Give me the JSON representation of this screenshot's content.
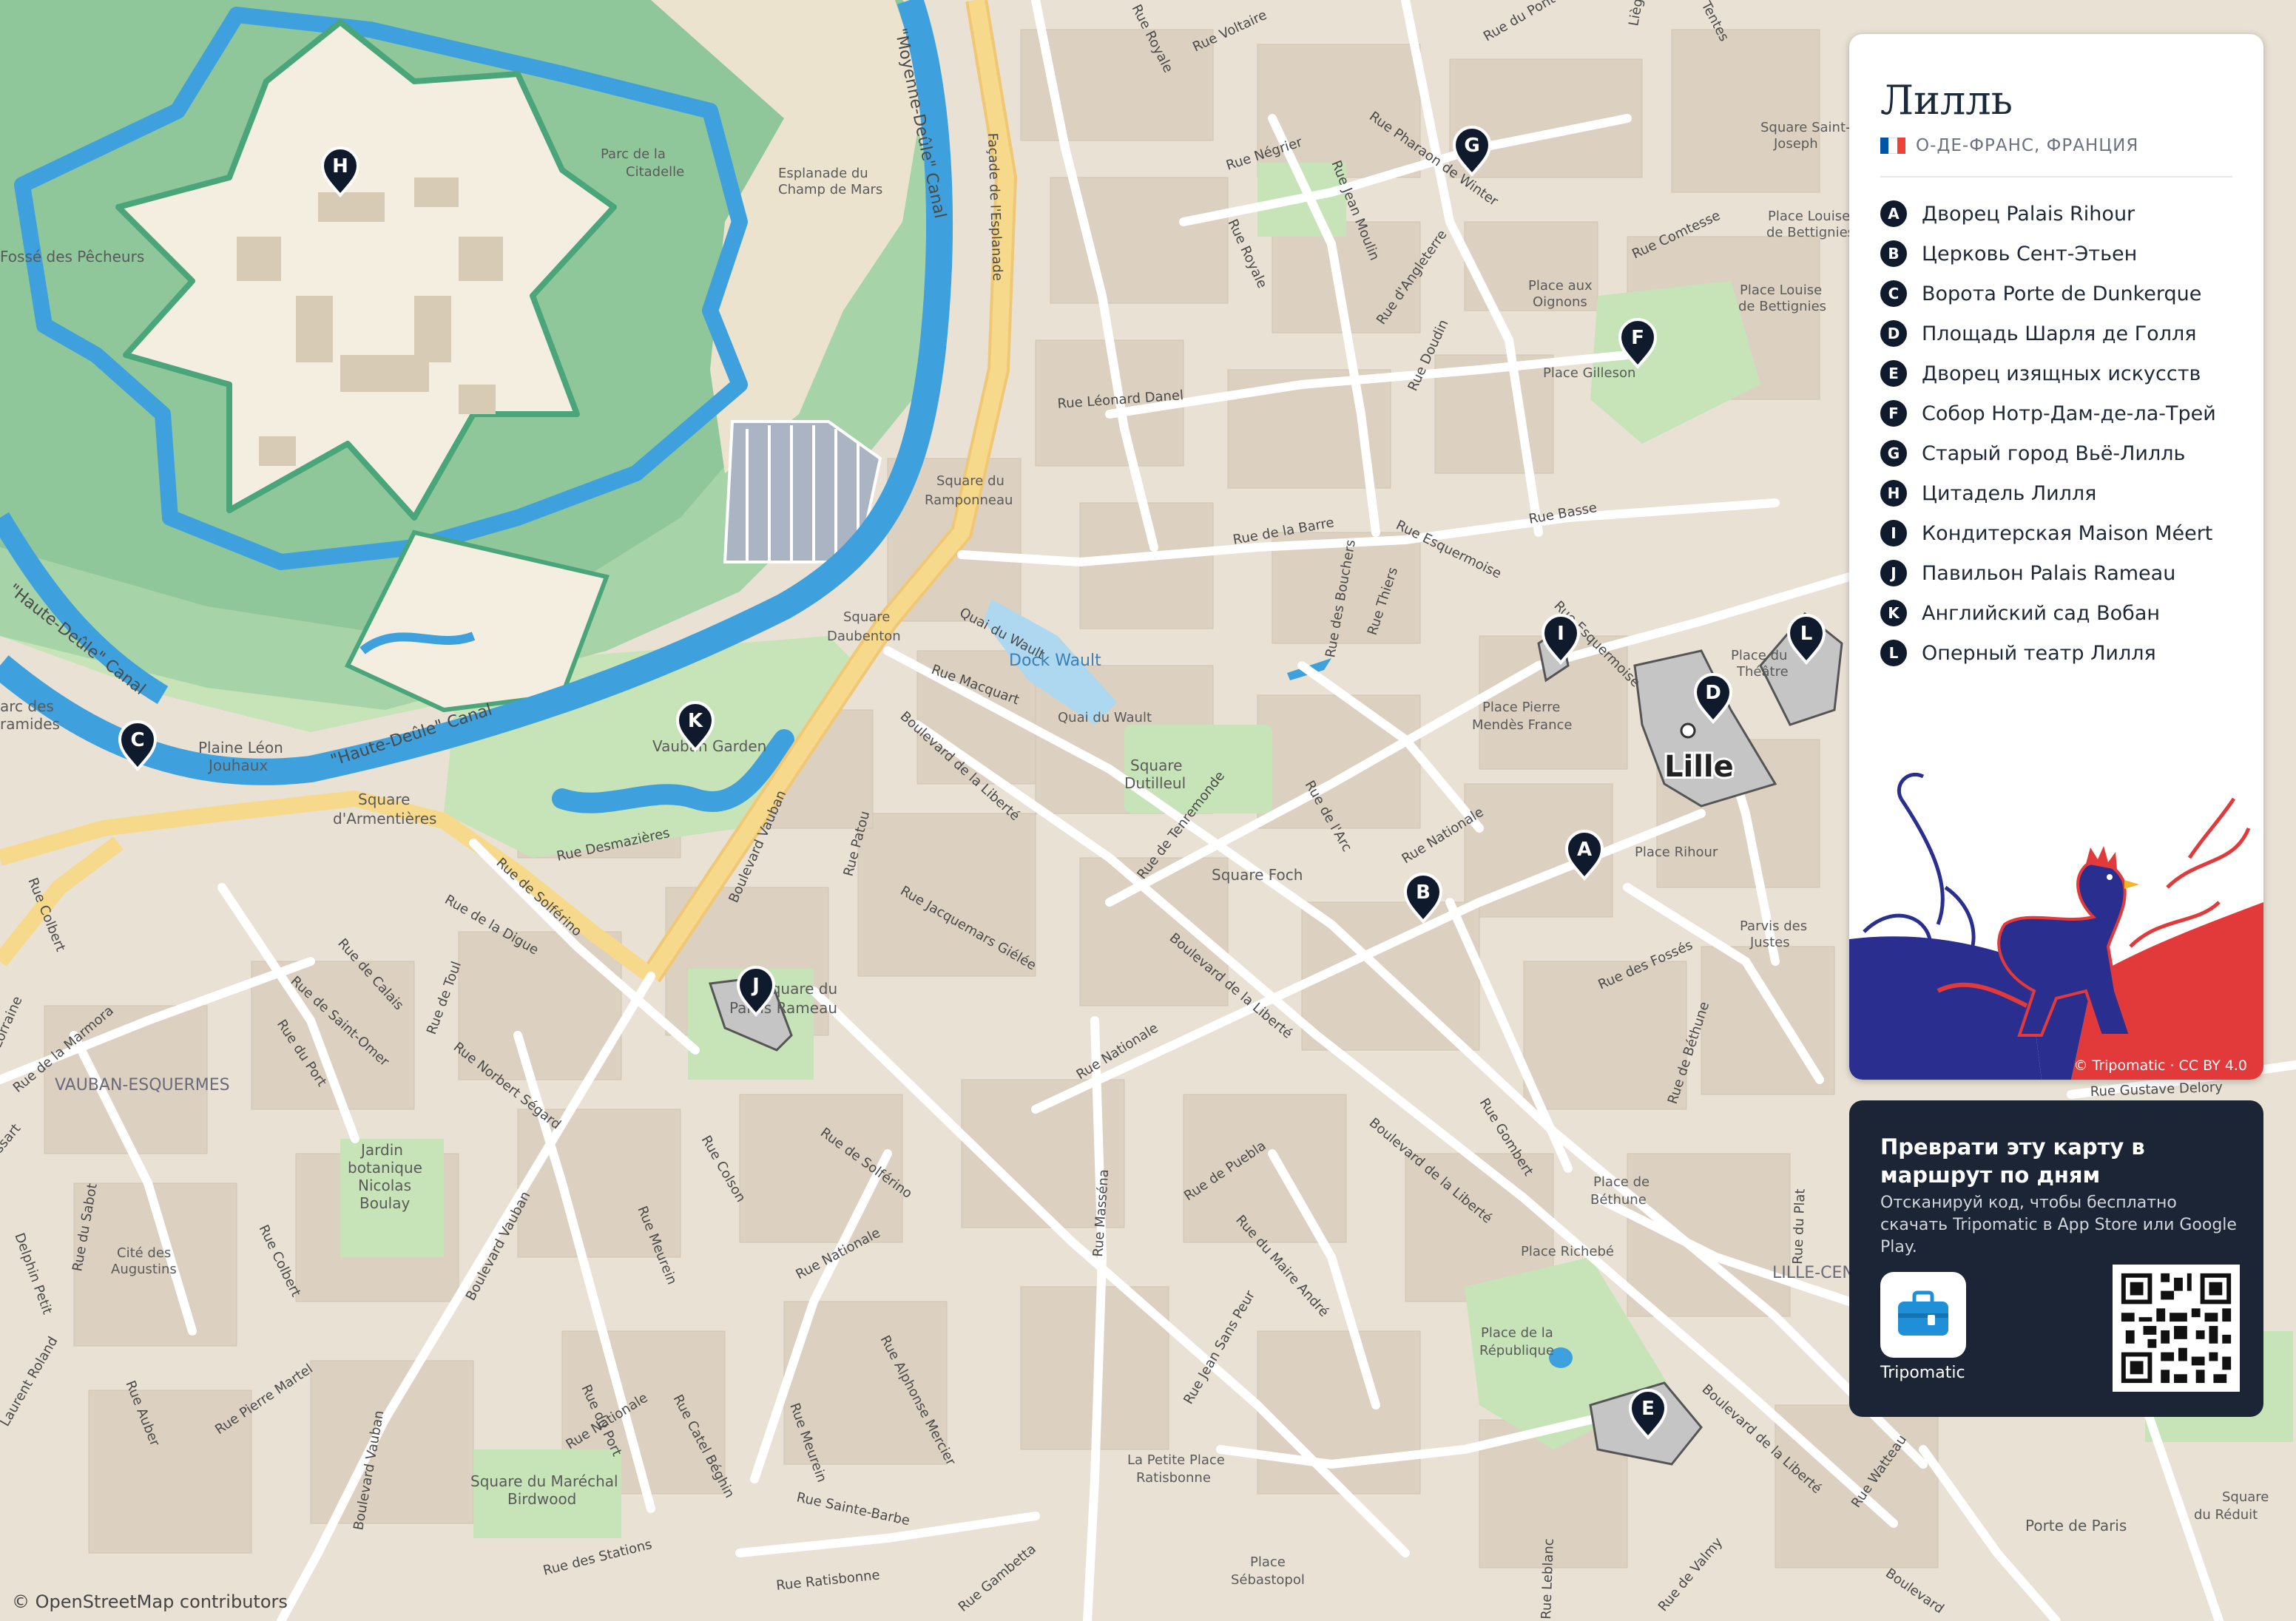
{
  "header": {
    "title": "Лилль",
    "region": "О-ДЕ-ФРАНС, ФРАНЦИЯ",
    "flag_colors": [
      "#0055a4",
      "#ffffff",
      "#ef4135"
    ]
  },
  "poi_list": [
    {
      "letter": "A",
      "name": "Дворец Palais Rihour"
    },
    {
      "letter": "B",
      "name": "Церковь Сент-Этьен"
    },
    {
      "letter": "C",
      "name": "Ворота Porte de Dunkerque"
    },
    {
      "letter": "D",
      "name": "Площадь Шарля де Голля"
    },
    {
      "letter": "E",
      "name": "Дворец изящных искусств"
    },
    {
      "letter": "F",
      "name": "Собор Нотр-Дам-де-ла-Трей"
    },
    {
      "letter": "G",
      "name": "Старый город Вьё-Лилль"
    },
    {
      "letter": "H",
      "name": "Цитадель Лилля"
    },
    {
      "letter": "I",
      "name": "Кондитерская Maison Méert"
    },
    {
      "letter": "J",
      "name": "Павильон Palais Rameau"
    },
    {
      "letter": "K",
      "name": "Английский сад Вобан"
    },
    {
      "letter": "L",
      "name": "Оперный театр Лилля"
    }
  ],
  "panel_credit": "© Tripomatic · CC BY 4.0",
  "cta": {
    "heading": "Преврати эту карту в маршрут по дням",
    "text": "Отсканируй код, чтобы бесплатно скачать Tripomatic в App Store или Google Play.",
    "app_name": "Tripomatic"
  },
  "map_attribution": "© OpenStreetMap contributors",
  "city_label": "Lille",
  "colors": {
    "marker": "#0f1b2d",
    "water": "#3ea0dd",
    "park": "#a6d49a",
    "citadel_green": "#8fc79a",
    "road_major": "#f7d98b",
    "land": "#e9e1d4",
    "cta_bg": "#1c2535"
  },
  "map_labels": {
    "canal_moyenne": "\"Moyenne-Deûle\" Canal",
    "canal_haute": "\"Haute-Deûle\" Canal",
    "canal_haute2": "\"Haute-Deûle\" Canal",
    "dock_wault": "Dock Wault",
    "fosse": "Fossé des Pêcheurs",
    "parc_citadelle_1": "Parc de la",
    "parc_citadelle_2": "Citadelle",
    "esplanade_1": "Esplanade du",
    "esplanade_2": "Champ de Mars",
    "facade": "Façade de l'Esplanade",
    "sq_ramponneau_1": "Square du",
    "sq_ramponneau_2": "Ramponneau",
    "sq_daubenton_1": "Square",
    "sq_daubenton_2": "Daubenton",
    "quai_wault_1": "Quai du Wault",
    "quai_wault_2": "Quai du Wault",
    "vauban_garden": "Vauban Garden",
    "plaine_1": "Plaine Léon",
    "plaine_2": "Jouhaux",
    "sq_arm_1": "Square",
    "sq_arm_2": "d'Armentières",
    "pyramides_1": "arc des",
    "pyramides_2": "ramides",
    "sq_dutilleul_1": "Square",
    "sq_dutilleul_2": "Dutilleul",
    "sq_foch": "Square Foch",
    "pl_mendes_1": "Place Pierre",
    "pl_mendes_2": "Mendès France",
    "pl_rihour": "Place Rihour",
    "pl_theatre_1": "Place du",
    "pl_theatre_2": "Théâtre",
    "pl_gilleson": "Place Gilleson",
    "pl_oignons_1": "Place aux",
    "pl_oignons_2": "Oignons",
    "pl_bettignies_1": "Place Louise",
    "pl_bettignies_2": "de Bettignies",
    "pl_bettignies_3": "Place Louise",
    "pl_bettignies_4": "de Bettignies",
    "sq_stjoseph_1": "Square Saint-",
    "sq_stjoseph_2": "Joseph",
    "parvis_1": "Parvis des",
    "parvis_2": "Justes",
    "pl_bethune_1": "Place de",
    "pl_bethune_2": "Béthune",
    "pl_richebe": "Place Richebé",
    "pl_republique_1": "Place de la",
    "pl_republique_2": "République",
    "petite_place_1": "La Petite Place",
    "petite_place_2": "Ratisbonne",
    "pl_sebastopol_1": "Place",
    "pl_sebastopol_2": "Sébastopol",
    "sq_birdwood_1": "Square du Maréchal",
    "sq_birdwood_2": "Birdwood",
    "jardin_1": "Jardin",
    "jardin_2": "botanique",
    "jardin_3": "Nicolas",
    "jardin_4": "Boulay",
    "cite_1": "Cité des",
    "cite_2": "Augustins",
    "vauban_esq": "VAUBAN-ESQUERMES",
    "lille_centre": "LILLE-CENTRE",
    "porte_paris": "Porte de Paris",
    "sq_reduit_1": "Square",
    "sq_reduit_2": "du Réduit",
    "sq_rameau_1": "Square du",
    "sq_rameau_2": "Palais Rameau",
    "rue_royale": "Rue Royale",
    "rue_royale2": "Rue Royale",
    "rue_voltaire": "Rue Voltaire",
    "rue_negrier": "Rue Négrier",
    "rue_jean_moulin": "Rue Jean Moulin",
    "rue_pharaon": "Rue Pharaon de Winter",
    "rue_angleterre": "Rue d'Angleterre",
    "rue_doudin": "Rue Doudin",
    "rue_comtesse": "Rue Comtesse",
    "rue_leonard": "Rue Léonard Danel",
    "rue_barre": "Rue de la Barre",
    "rue_esquermoise": "Rue Esquermoise",
    "rue_basse": "Rue Basse",
    "rue_bouchers": "Rue des Bouchers",
    "rue_thiers": "Rue Thiers",
    "rue_esquermoise2": "Rue Esquermoise",
    "rue_macquart": "Rue Macquart",
    "bd_liberte1": "Boulevard de la Liberté",
    "bd_liberte2": "Boulevard de la Liberté",
    "bd_liberte3": "Boulevard de la Liberté",
    "bd_liberte4": "Boulevard de la Liberté",
    "rue_tenremonde": "Rue de Tenremonde",
    "rue_arc": "Rue de l'Arc",
    "rue_nationale1": "Rue Nationale",
    "rue_nationale2": "Rue Nationale",
    "rue_nationale3": "Rue Nationale",
    "rue_nationale4": "Rue Nationale",
    "rue_patou": "Rue Patou",
    "rue_jacquemars": "Rue Jacquemars Giélée",
    "bd_vauban1": "Boulevard Vauban",
    "bd_vauban2": "Boulevard Vauban",
    "bd_vauban3": "Boulevard Vauban",
    "rue_desmazieres": "Rue Desmazières",
    "rue_solferino1": "Rue de Solférino",
    "rue_solferino2": "Rue de Solférino",
    "rue_digue": "Rue de la Digue",
    "rue_calais": "Rue de Calais",
    "rue_toul": "Rue de Toul",
    "rue_st_omer": "Rue de Saint-Omer",
    "rue_port1": "Rue du Port",
    "rue_port2": "Rue du Port",
    "rue_norbert": "Rue Norbert Ségard",
    "rue_marmora": "Rue de la Marmora",
    "rue_colbert1": "Rue Colbert",
    "rue_colbert2": "Rue Colbert",
    "rue_colson": "Rue Colson",
    "rue_meurein1": "Rue Meurein",
    "rue_meurein2": "Rue Meurein",
    "rue_massena": "Rue Masséna",
    "rue_puebla": "Rue de Puebla",
    "rue_maire_andre": "Rue du Maire André",
    "rue_jean_sans_peur": "Rue Jean Sans Peur",
    "rue_alphonse": "Rue Alphonse Mercier",
    "rue_gombert": "Rue Gombert",
    "rue_fosses": "Rue des Fossés",
    "rue_bethune": "Rue de Béthune",
    "rue_gustave": "Rue Gustave Delory",
    "rue_plat": "Rue du Plat",
    "rue_watteau": "Rue Watteau",
    "rue_sainte_barbe": "Rue Sainte-Barbe",
    "rue_ratisbonne": "Rue Ratisbonne",
    "rue_stations": "Rue des Stations",
    "rue_catel": "Rue Catel Béghin",
    "rue_auber": "Rue Auber",
    "rue_pierre_martel": "Rue Pierre Martel",
    "rue_sabot": "Rue du Sabot",
    "rue_delphin": "Delphin Petit",
    "rue_laurent": "Laurent Roland",
    "rue_gambetta": "Rue Gambetta",
    "rue_valmy": "Rue de Valmy",
    "rue_leblanc": "Rue Leblanc",
    "rue_colbert_left": "Rue Colbert",
    "rue_lorraine": "Lorraine",
    "rue_essart": "ssart",
    "rue_pont": "Rue du Pont",
    "rue_tentes": "Tentes",
    "rue_liege": "Liège",
    "bd_left": "Boulevard"
  },
  "markers": [
    "A",
    "B",
    "C",
    "D",
    "E",
    "F",
    "G",
    "H",
    "I",
    "J",
    "K",
    "L"
  ]
}
